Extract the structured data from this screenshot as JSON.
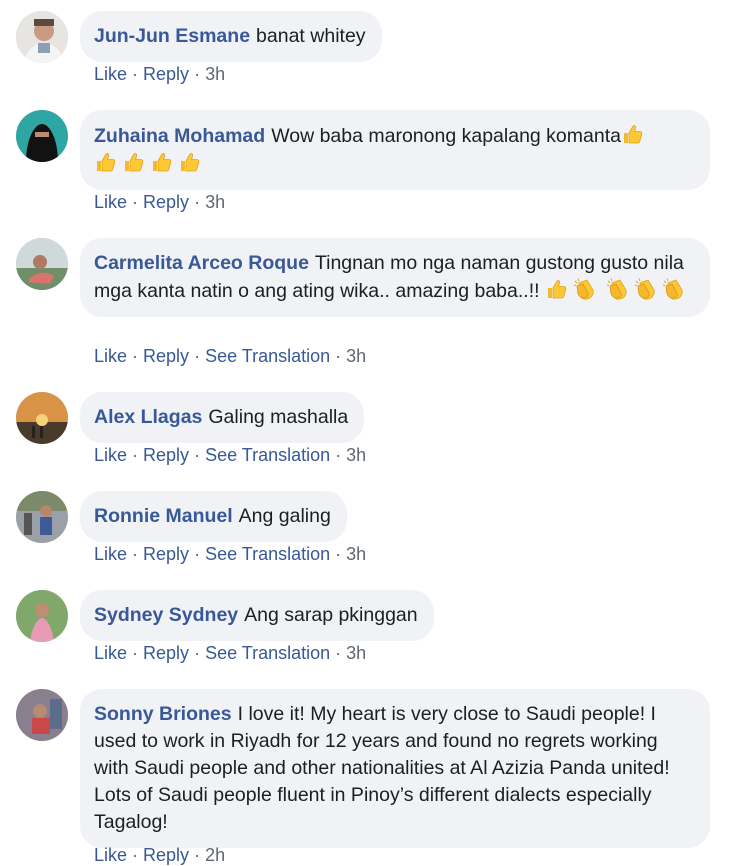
{
  "comments": [
    {
      "author": "Jun-Jun Esmane",
      "text": "banat whitey",
      "actions": {
        "like": "Like",
        "reply": "Reply",
        "translate": "",
        "time": "3h"
      }
    },
    {
      "author": "Zuhaina Mohamad",
      "text": "Wow baba maronong kapalang komanta",
      "actions": {
        "like": "Like",
        "reply": "Reply",
        "translate": "",
        "time": "3h"
      }
    },
    {
      "author": "Carmelita Arceo Roque",
      "text": "Tingnan mo nga naman gustong gusto nila mga kanta natin o ang ating wika.. amazing baba..!!",
      "actions": {
        "like": "Like",
        "reply": "Reply",
        "translate": "See Translation",
        "time": "3h"
      }
    },
    {
      "author": "Alex Llagas",
      "text": "Galing mashalla",
      "actions": {
        "like": "Like",
        "reply": "Reply",
        "translate": "See Translation",
        "time": "3h"
      }
    },
    {
      "author": "Ronnie Manuel",
      "text": "Ang galing",
      "actions": {
        "like": "Like",
        "reply": "Reply",
        "translate": "See Translation",
        "time": "3h"
      }
    },
    {
      "author": "Sydney Sydney",
      "text": "Ang sarap pkinggan",
      "actions": {
        "like": "Like",
        "reply": "Reply",
        "translate": "See Translation",
        "time": "3h"
      }
    },
    {
      "author": "Sonny Briones",
      "text": "I love it! My heart is very close to Saudi people! I used to work in Riyadh for 12 years and found no regrets working with Saudi people and other nationalities at Al Azizia Panda united! Lots of Saudi people fluent in Pinoy’s different dialects especially Tagalog!",
      "actions": {
        "like": "Like",
        "reply": "Reply",
        "translate": "",
        "time": "2h"
      }
    }
  ],
  "icons": {
    "thumbs_up": "thumbs-up-emoji",
    "clapping": "clapping-hands-emoji"
  },
  "colors": {
    "author": "#385898",
    "bubble": "#f0f2f5",
    "text": "#1c1e21",
    "meta": "#606770"
  }
}
